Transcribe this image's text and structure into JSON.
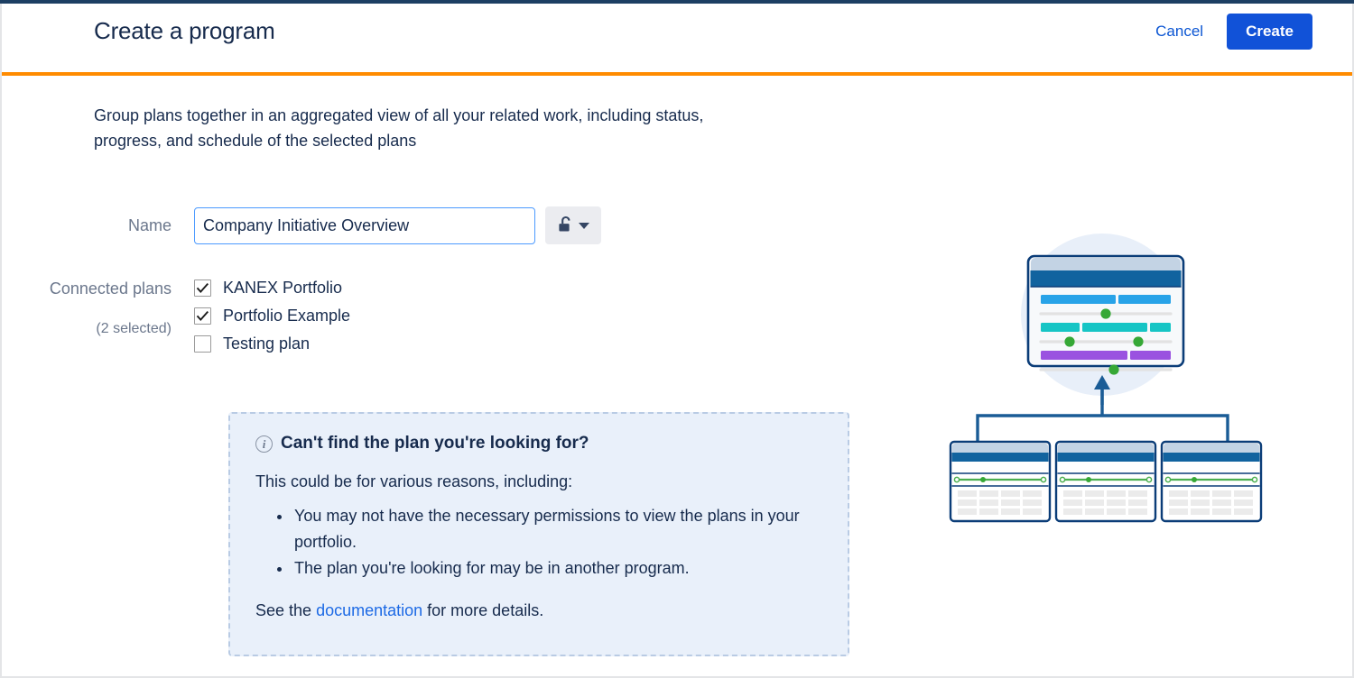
{
  "window": {
    "title": "Create a program",
    "accent_orange": "#ff8b00",
    "top_bar_navy": "#1c3f63"
  },
  "header": {
    "title": "Create a program",
    "cancel_label": "Cancel",
    "create_label": "Create",
    "create_button_color": "#1152d8"
  },
  "main": {
    "description": "Group plans together in an aggregated view of all your related work, including status, progress, and schedule of the selected plans",
    "name_field": {
      "label": "Name",
      "value": "Company Initiative Overview",
      "placeholder": "Name",
      "visibility_button_icon": "unlocked-padlock-icon",
      "visibility_button_caret": "chevron-down-icon"
    },
    "connected_plans": {
      "label": "Connected plans",
      "selected_count_label": "(2 selected)",
      "items": [
        {
          "label": "KANEX Portfolio",
          "checked": true
        },
        {
          "label": "Portfolio Example",
          "checked": true
        },
        {
          "label": "Testing plan",
          "checked": false
        }
      ]
    },
    "info_panel": {
      "icon": "info-circle-icon",
      "heading": "Can't find the plan you're looking for?",
      "subheading": "This could be for various reasons, including:",
      "bullets": [
        "You may not have the necessary permissions to view the plans in your portfolio.",
        "The plan you're looking for may be in another program."
      ],
      "footer_prefix": "See the ",
      "footer_link": "documentation",
      "footer_suffix": " for more details.",
      "background": "#e9f0fa",
      "border_color": "#b9cbe4",
      "link_color": "#1d6ae5"
    }
  },
  "illustration": {
    "name": "program-aggregation-illustration",
    "description": "A large program board card above three smaller plan cards connected by an upward arrow",
    "colors": {
      "circle_backdrop": "#e8eff9",
      "card_outline": "#0b3d78",
      "card_header_dark": "#11639f",
      "card_header_light": "#c3d3e4",
      "bar_blue": "#28a3e8",
      "bar_teal": "#16c5c5",
      "bar_purple": "#9a52e0",
      "dot_green": "#36a836",
      "track_gray": "#e2e2e2",
      "cell_gray": "#ebebeb"
    }
  }
}
